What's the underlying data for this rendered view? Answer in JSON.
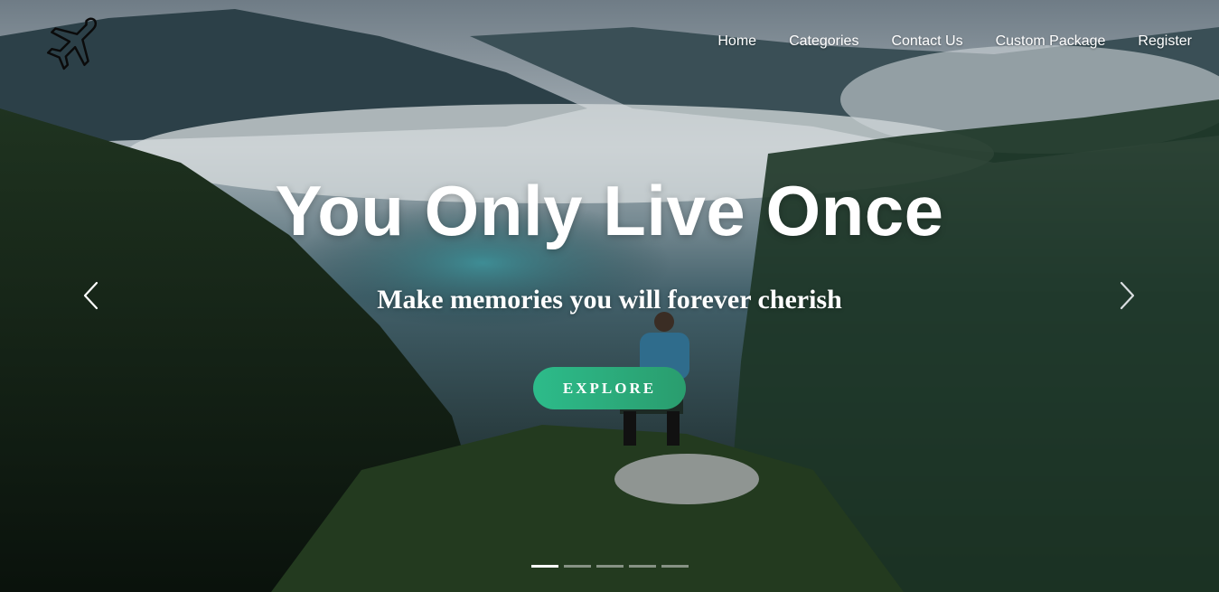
{
  "nav": {
    "items": [
      {
        "label": "Home"
      },
      {
        "label": "Categories"
      },
      {
        "label": "Contact Us"
      },
      {
        "label": "Custom Package"
      },
      {
        "label": "Register"
      }
    ]
  },
  "logo": {
    "icon": "airplane-icon"
  },
  "hero": {
    "headline": "You Only Live Once",
    "subheadline": "Make memories you will forever cherish",
    "cta_label": "EXPLORE",
    "cta_color": "#2dbb8a",
    "prev_icon": "chevron-left-icon",
    "next_icon": "chevron-right-icon",
    "slides_count": 5,
    "active_slide": 1
  }
}
